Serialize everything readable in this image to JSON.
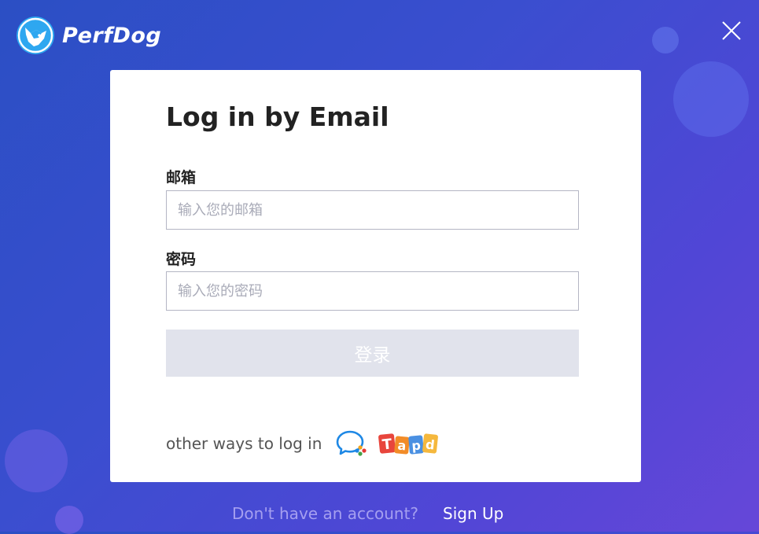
{
  "app": {
    "brand_name": "PerfDog",
    "logo_icon": "fox-logo-icon",
    "close_icon": "close-icon"
  },
  "colors": {
    "background_start": "#2b4fc4",
    "background_end": "#6647d8",
    "card_background": "#ffffff",
    "login_button_disabled": "#e1e3ec",
    "footer_prompt": "#a59ff0"
  },
  "login_form": {
    "title": "Log in by Email",
    "email_label": "邮箱",
    "email_placeholder": "输入您的邮箱",
    "email_value": "",
    "password_label": "密码",
    "password_placeholder": "输入您的密码",
    "password_value": "",
    "submit_label": "登录",
    "submit_state": "disabled-looking"
  },
  "other_login": {
    "label": "other ways to log in",
    "providers": [
      {
        "name": "wecom",
        "icon": "wecom-chat-icon"
      },
      {
        "name": "tapd",
        "icon": "tapd-logo-icon",
        "logo_text": "Tapd"
      }
    ]
  },
  "footer": {
    "prompt": "Don't have an account?",
    "signup_label": "Sign Up"
  }
}
